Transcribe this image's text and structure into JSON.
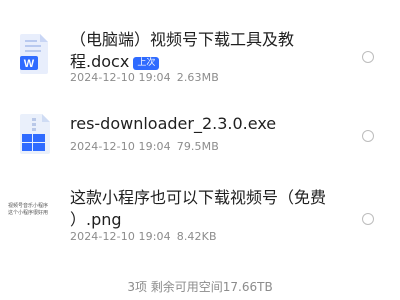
{
  "files": [
    {
      "icon": "word-doc-icon",
      "name_line1": "（电脑端）视频号下载工具及教",
      "name_line2": "程.docx",
      "badge": "上次",
      "date": "2024-12-10 19:04",
      "size": "2.63MB"
    },
    {
      "icon": "archive-exe-icon",
      "name_line1": "res-downloader_2.3.0.exe",
      "date": "2024-12-10 19:04",
      "size": "79.5MB"
    },
    {
      "icon": "image-thumbnail-icon",
      "name_line1": "这款小程序也可以下载视频号（免费",
      "name_line2": "）.png",
      "date": "2024-12-10 19:04",
      "size": "8.42KB",
      "thumb_text_1": "视频号音乐小程序",
      "thumb_text_2": "这个小程序很好用"
    }
  ],
  "footer": "3项  剩余可用空间17.66TB",
  "colors": {
    "accent": "#2f6bff",
    "text": "#1f1f1f",
    "meta": "#8c8c8c"
  }
}
